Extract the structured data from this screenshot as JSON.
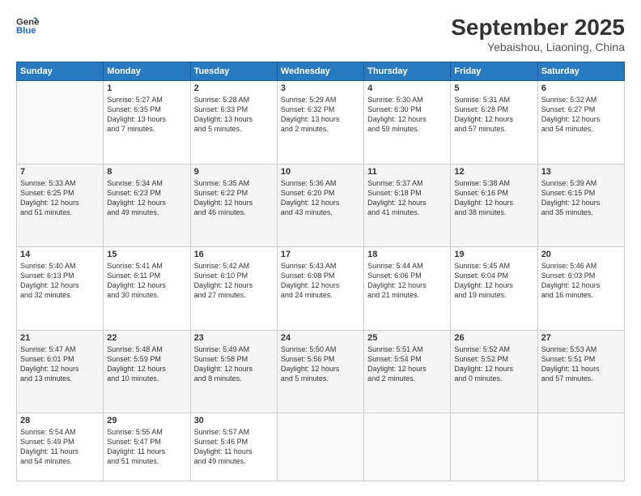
{
  "header": {
    "logo_line1": "General",
    "logo_line2": "Blue",
    "month_year": "September 2025",
    "location": "Yebaishou, Liaoning, China"
  },
  "weekdays": [
    "Sunday",
    "Monday",
    "Tuesday",
    "Wednesday",
    "Thursday",
    "Friday",
    "Saturday"
  ],
  "weeks": [
    [
      {
        "day": "",
        "text": ""
      },
      {
        "day": "1",
        "text": "Sunrise: 5:27 AM\nSunset: 6:35 PM\nDaylight: 13 hours\nand 7 minutes."
      },
      {
        "day": "2",
        "text": "Sunrise: 5:28 AM\nSunset: 6:33 PM\nDaylight: 13 hours\nand 5 minutes."
      },
      {
        "day": "3",
        "text": "Sunrise: 5:29 AM\nSunset: 6:32 PM\nDaylight: 13 hours\nand 2 minutes."
      },
      {
        "day": "4",
        "text": "Sunrise: 5:30 AM\nSunset: 6:30 PM\nDaylight: 12 hours\nand 59 minutes."
      },
      {
        "day": "5",
        "text": "Sunrise: 5:31 AM\nSunset: 6:28 PM\nDaylight: 12 hours\nand 57 minutes."
      },
      {
        "day": "6",
        "text": "Sunrise: 5:32 AM\nSunset: 6:27 PM\nDaylight: 12 hours\nand 54 minutes."
      }
    ],
    [
      {
        "day": "7",
        "text": "Sunrise: 5:33 AM\nSunset: 6:25 PM\nDaylight: 12 hours\nand 51 minutes."
      },
      {
        "day": "8",
        "text": "Sunrise: 5:34 AM\nSunset: 6:23 PM\nDaylight: 12 hours\nand 49 minutes."
      },
      {
        "day": "9",
        "text": "Sunrise: 5:35 AM\nSunset: 6:22 PM\nDaylight: 12 hours\nand 46 minutes."
      },
      {
        "day": "10",
        "text": "Sunrise: 5:36 AM\nSunset: 6:20 PM\nDaylight: 12 hours\nand 43 minutes."
      },
      {
        "day": "11",
        "text": "Sunrise: 5:37 AM\nSunset: 6:18 PM\nDaylight: 12 hours\nand 41 minutes."
      },
      {
        "day": "12",
        "text": "Sunrise: 5:38 AM\nSunset: 6:16 PM\nDaylight: 12 hours\nand 38 minutes."
      },
      {
        "day": "13",
        "text": "Sunrise: 5:39 AM\nSunset: 6:15 PM\nDaylight: 12 hours\nand 35 minutes."
      }
    ],
    [
      {
        "day": "14",
        "text": "Sunrise: 5:40 AM\nSunset: 6:13 PM\nDaylight: 12 hours\nand 32 minutes."
      },
      {
        "day": "15",
        "text": "Sunrise: 5:41 AM\nSunset: 6:11 PM\nDaylight: 12 hours\nand 30 minutes."
      },
      {
        "day": "16",
        "text": "Sunrise: 5:42 AM\nSunset: 6:10 PM\nDaylight: 12 hours\nand 27 minutes."
      },
      {
        "day": "17",
        "text": "Sunrise: 5:43 AM\nSunset: 6:08 PM\nDaylight: 12 hours\nand 24 minutes."
      },
      {
        "day": "18",
        "text": "Sunrise: 5:44 AM\nSunset: 6:06 PM\nDaylight: 12 hours\nand 21 minutes."
      },
      {
        "day": "19",
        "text": "Sunrise: 5:45 AM\nSunset: 6:04 PM\nDaylight: 12 hours\nand 19 minutes."
      },
      {
        "day": "20",
        "text": "Sunrise: 5:46 AM\nSunset: 6:03 PM\nDaylight: 12 hours\nand 16 minutes."
      }
    ],
    [
      {
        "day": "21",
        "text": "Sunrise: 5:47 AM\nSunset: 6:01 PM\nDaylight: 12 hours\nand 13 minutes."
      },
      {
        "day": "22",
        "text": "Sunrise: 5:48 AM\nSunset: 5:59 PM\nDaylight: 12 hours\nand 10 minutes."
      },
      {
        "day": "23",
        "text": "Sunrise: 5:49 AM\nSunset: 5:58 PM\nDaylight: 12 hours\nand 8 minutes."
      },
      {
        "day": "24",
        "text": "Sunrise: 5:50 AM\nSunset: 5:56 PM\nDaylight: 12 hours\nand 5 minutes."
      },
      {
        "day": "25",
        "text": "Sunrise: 5:51 AM\nSunset: 5:54 PM\nDaylight: 12 hours\nand 2 minutes."
      },
      {
        "day": "26",
        "text": "Sunrise: 5:52 AM\nSunset: 5:52 PM\nDaylight: 12 hours\nand 0 minutes."
      },
      {
        "day": "27",
        "text": "Sunrise: 5:53 AM\nSunset: 5:51 PM\nDaylight: 11 hours\nand 57 minutes."
      }
    ],
    [
      {
        "day": "28",
        "text": "Sunrise: 5:54 AM\nSunset: 5:49 PM\nDaylight: 11 hours\nand 54 minutes."
      },
      {
        "day": "29",
        "text": "Sunrise: 5:55 AM\nSunset: 5:47 PM\nDaylight: 11 hours\nand 51 minutes."
      },
      {
        "day": "30",
        "text": "Sunrise: 5:57 AM\nSunset: 5:46 PM\nDaylight: 11 hours\nand 49 minutes."
      },
      {
        "day": "",
        "text": ""
      },
      {
        "day": "",
        "text": ""
      },
      {
        "day": "",
        "text": ""
      },
      {
        "day": "",
        "text": ""
      }
    ]
  ]
}
